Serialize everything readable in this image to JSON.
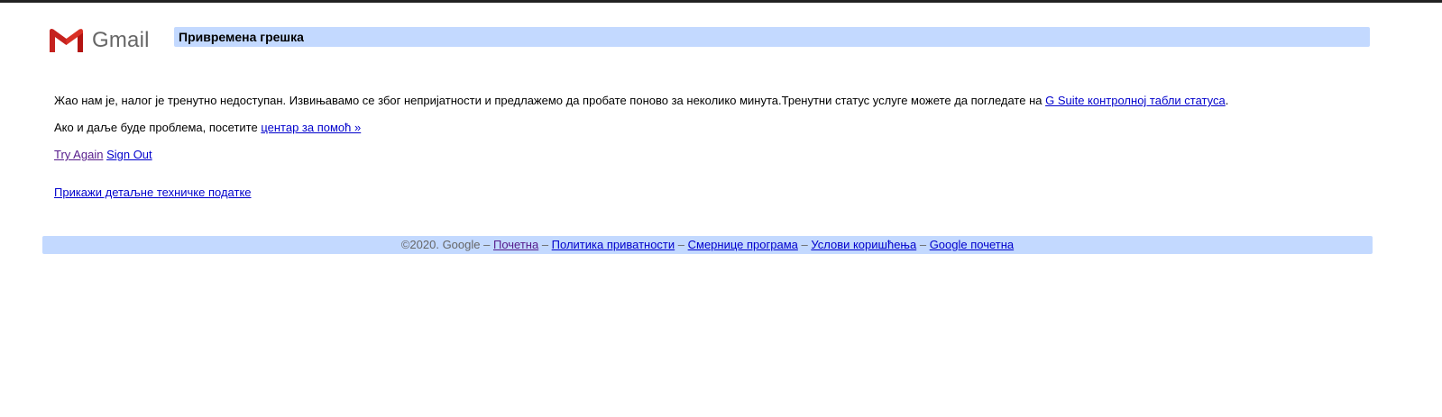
{
  "brand": {
    "name": "Gmail",
    "icon": "gmail-m-logo-icon",
    "colors": {
      "red": "#d93025",
      "red_dark": "#b31412",
      "gray_text": "#666666"
    }
  },
  "header": {
    "title": "Привремена грешка",
    "bar_color": "#c3d9ff"
  },
  "message": {
    "line1_text": "Жао нам је, налог је тренутно недоступан. Извињавамо се због непријатности и предлажемо да пробате поново за неколико минута.Тренутни статус услуге можете да погледате на ",
    "line1_link": "G Suite контролној табли статуса",
    "line1_end": ".",
    "line2_text": "Ако и даље буде проблема, посетите ",
    "line2_link": "центар за помоћ »"
  },
  "actions": {
    "try_again": "Try Again",
    "sign_out": "Sign Out",
    "show_details": "Прикажи детаљне техничке податке"
  },
  "footer": {
    "copyright": "©2020. Google",
    "separator": " – ",
    "links": [
      "Почетна",
      "Политика приватности",
      "Смернице програма",
      "Услови коришћења",
      "Google почетна"
    ]
  },
  "colors": {
    "link": "#0000cc",
    "visited_link": "#551a8b",
    "top_bar": "#222222"
  }
}
